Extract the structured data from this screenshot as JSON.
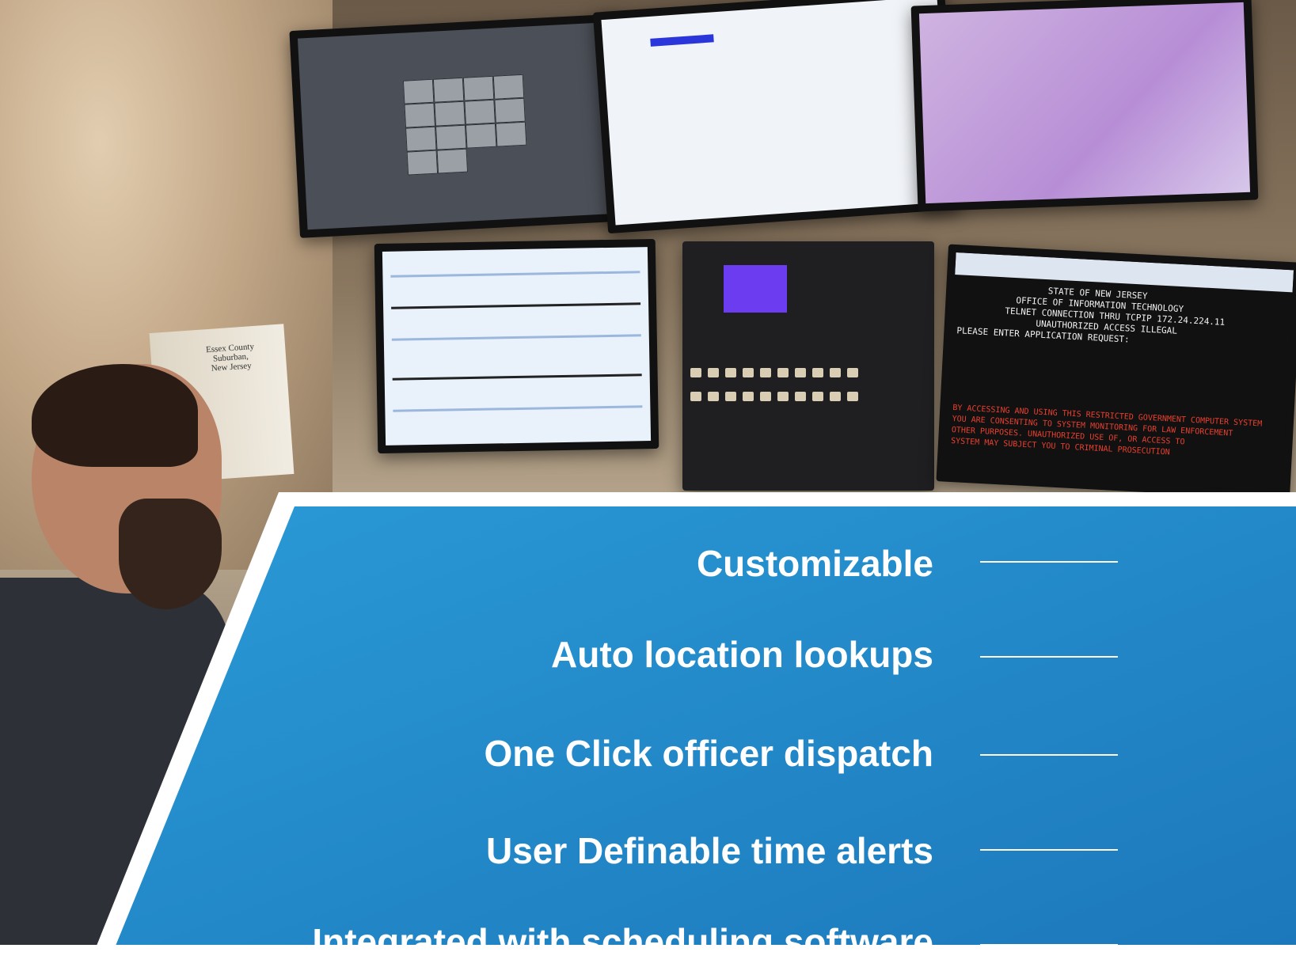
{
  "features": [
    "Customizable",
    "Auto location lookups",
    "One Click officer dispatch",
    "User Definable time alerts",
    "Integrated with scheduling software"
  ],
  "terminal": {
    "header_lines": "                 STATE OF NEW JERSEY\n           OFFICE OF INFORMATION TECHNOLOGY\n         TELNET CONNECTION THRU TCPIP 172.24.224.11\n               UNAUTHORIZED ACCESS ILLEGAL\nPLEASE ENTER APPLICATION REQUEST:",
    "warning_lines": "BY ACCESSING AND USING THIS RESTRICTED GOVERNMENT COMPUTER SYSTEM\nYOU ARE CONSENTING TO SYSTEM MONITORING FOR LAW ENFORCEMENT\nOTHER PURPOSES. UNAUTHORIZED USE OF, OR ACCESS TO\nSYSTEM MAY SUBJECT YOU TO CRIMINAL PROSECUTION"
  },
  "book_title": "Essex County\nSuburban,\nNew Jersey",
  "colors": {
    "panel_blue": "#2a92cf",
    "panel_blue_dark": "#1c74b5",
    "panel_border": "#ffffff",
    "text": "#ffffff"
  }
}
